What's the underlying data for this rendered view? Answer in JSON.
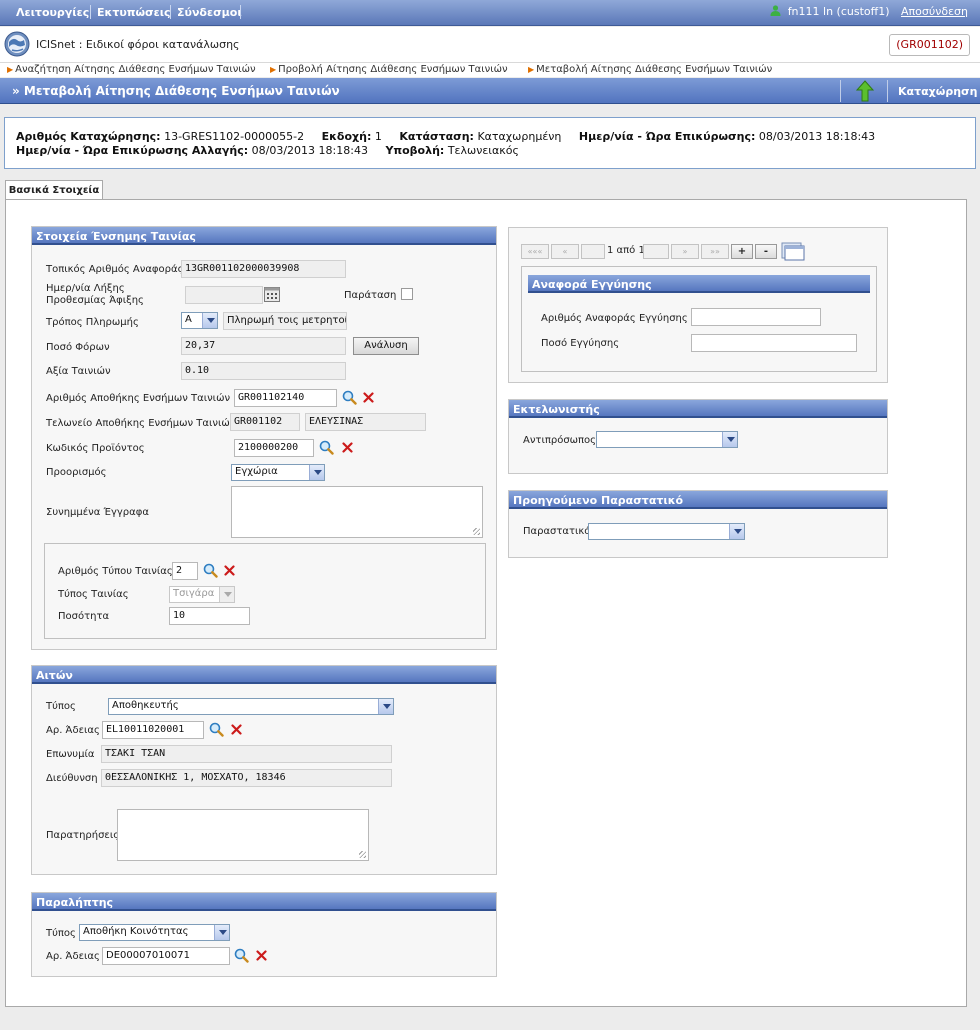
{
  "menu": {
    "items": [
      "Λειτουργίες",
      "Εκτυπώσεις",
      "Σύνδεσμοι"
    ],
    "user": "fn111 ln (custoff1)",
    "logout": "Αποσύνδεση"
  },
  "app": {
    "title": "ICISnet : Ειδικοί φόροι κατανάλωσης",
    "office": "(GR001102)"
  },
  "breadcrumb": [
    "Αναζήτηση Αίτησης Διάθεσης Ενσήμων Ταινιών",
    "Προβολή Αίτησης Διάθεσης Ενσήμων Ταινιών",
    "Μεταβολή Αίτησης Διάθεσης Ενσήμων Ταινιών"
  ],
  "page": {
    "title": "» Μεταβολή Αίτησης Διάθεσης Ενσήμων Ταινιών",
    "submit": "Καταχώρηση"
  },
  "info": {
    "reg_no_label": "Αριθμός Καταχώρησης:",
    "reg_no": "13-GRES1102-0000055-2",
    "version_label": "Εκδοχή:",
    "version": "1",
    "status_label": "Κατάσταση:",
    "status": "Καταχωρημένη",
    "confirm_label": "Ημερ/νία - Ώρα Επικύρωσης:",
    "confirm": "08/03/2013 18:18:43",
    "change_label": "Ημερ/νία - Ώρα Επικύρωσης Αλλαγής:",
    "change": "08/03/2013 18:18:43",
    "submission_label": "Υποβολή:",
    "submission": "Τελωνειακός"
  },
  "tabs": [
    "Βασικά Στοιχεία"
  ],
  "stamp": {
    "header": "Στοιχεία Ένσημης Ταινίας",
    "local_ref_label": "Τοπικός Αριθμός Αναφοράς",
    "local_ref": "13GR001102000039908",
    "deadline_label_1": "Ημερ/νία Λήξης",
    "deadline_label_2": "Προθεσμίας Άφιξης",
    "extension_label": "Παράταση",
    "payment_label": "Τρόπος Πληρωμής",
    "payment_code": "A",
    "payment_desc": "Πληρωμή τοις μετρητοίς",
    "tax_label": "Ποσό Φόρων",
    "tax": "20,37",
    "analysis_button": "Ανάλυση",
    "value_label": "Αξία Ταινιών",
    "value": "0.10",
    "warehouse_label": "Αριθμός Αποθήκης Ενσήμων Ταινιών",
    "warehouse": "GR001102140",
    "customs_label": "Τελωνείο Αποθήκης Ενσήμων Ταινιών",
    "customs_code": "GR001102",
    "customs_name": "ΕΛΕΥΣΙΝΑΣ",
    "product_label": "Κωδικός Προϊόντος",
    "product": "2100000200",
    "destination_label": "Προορισμός",
    "destination": "Εγχώρια",
    "attachments_label": "Συνημμένα Έγγραφα",
    "type_no_label": "Αριθμός Τύπου Ταινίας",
    "type_no": "2",
    "stamp_type_label": "Τύπος Ταινίας",
    "stamp_type": "Τσιγάρα",
    "quantity_label": "Ποσότητα",
    "quantity": "10"
  },
  "applicant": {
    "header": "Αιτών",
    "type_label": "Τύπος",
    "type": "Αποθηκευτής",
    "license_label": "Αρ. Άδειας",
    "license": "EL10011020001",
    "name_label": "Επωνυμία",
    "name": "ΤΣΑΚΙ ΤΣΑΝ",
    "address_label": "Διεύθυνση",
    "address": "ΘΕΣΣΑΛΟΝΙΚΗΣ 1, ΜΟΣΧΑΤΟ, 18346",
    "notes_label": "Παρατηρήσεις"
  },
  "receiver": {
    "header": "Παραλήπτης",
    "type_label": "Τύπος",
    "type": "Αποθήκη Κοινότητας",
    "license_label": "Αρ. Άδειας",
    "license": "DE00007010071"
  },
  "guarantee": {
    "pager": {
      "first": "«««",
      "prev": "«",
      "page_info": "1 από 1",
      "next": "»",
      "last": "»»",
      "add": "+",
      "remove": "-"
    },
    "header": "Αναφορά Εγγύησης",
    "ref_label": "Αριθμός Αναφοράς Εγγύησης",
    "amount_label": "Ποσό Εγγύησης"
  },
  "executor": {
    "header": "Εκτελωνιστής",
    "rep_label": "Αντιπρόσωπος"
  },
  "previous": {
    "header": "Προηγούμενο Παραστατικό",
    "doc_label": "Παραστατικό"
  },
  "colors": {
    "accent": "#5676bf",
    "office_text": "#a00000",
    "arrow": "#e07000"
  }
}
